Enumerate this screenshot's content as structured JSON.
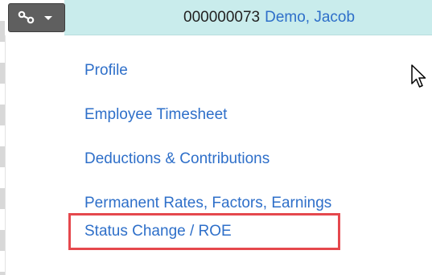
{
  "header": {
    "employee_id": "000000073",
    "employee_name": "Demo, Jacob"
  },
  "action_button": {
    "icon": "link-icon",
    "caret": "caret-down-icon"
  },
  "menu": {
    "items": [
      {
        "label": "Profile"
      },
      {
        "label": "Employee Timesheet"
      },
      {
        "label": "Deductions & Contributions"
      },
      {
        "label": "Permanent Rates, Factors, Earnings"
      },
      {
        "label": "Status Change / ROE"
      }
    ],
    "highlighted_index": 4
  },
  "colors": {
    "header_bg": "#c9ecec",
    "link": "#2e6fc9",
    "button_bg": "#5f5f5f",
    "highlight_border": "#e5484d"
  },
  "cursor": "pointer-arrow-icon"
}
